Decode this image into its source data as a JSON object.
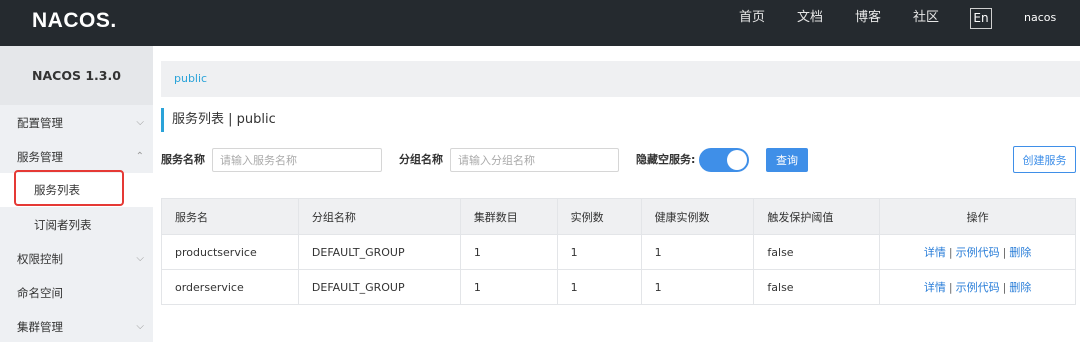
{
  "header": {
    "logo": "NACOS.",
    "nav": [
      "首页",
      "文档",
      "博客",
      "社区"
    ],
    "lang": "En",
    "user": "nacos"
  },
  "sidebar": {
    "version": "NACOS 1.3.0",
    "items": [
      {
        "label": "配置管理",
        "chevron": "⌵"
      },
      {
        "label": "服务管理",
        "chevron": "⌃"
      },
      {
        "label": "服务列表"
      },
      {
        "label": "订阅者列表"
      },
      {
        "label": "权限控制",
        "chevron": "⌵"
      },
      {
        "label": "命名空间"
      },
      {
        "label": "集群管理",
        "chevron": "⌵"
      }
    ]
  },
  "breadcrumb": "public",
  "page": {
    "title": "服务列表 | public"
  },
  "filters": {
    "service_label": "服务名称",
    "service_placeholder": "请输入服务名称",
    "group_label": "分组名称",
    "group_placeholder": "请输入分组名称",
    "hide_empty_label": "隐藏空服务:",
    "query_button": "查询",
    "create_button": "创建服务"
  },
  "table": {
    "headers": [
      "服务名",
      "分组名称",
      "集群数目",
      "实例数",
      "健康实例数",
      "触发保护阈值",
      "操作"
    ],
    "rows": [
      {
        "name": "productservice",
        "group": "DEFAULT_GROUP",
        "clusters": "1",
        "instances": "1",
        "healthy": "1",
        "threshold": "false",
        "actions": [
          "详情",
          "示例代码",
          "删除"
        ]
      },
      {
        "name": "orderservice",
        "group": "DEFAULT_GROUP",
        "clusters": "1",
        "instances": "1",
        "healthy": "1",
        "threshold": "false",
        "actions": [
          "详情",
          "示例代码",
          "删除"
        ]
      }
    ],
    "action_separator": "|"
  }
}
